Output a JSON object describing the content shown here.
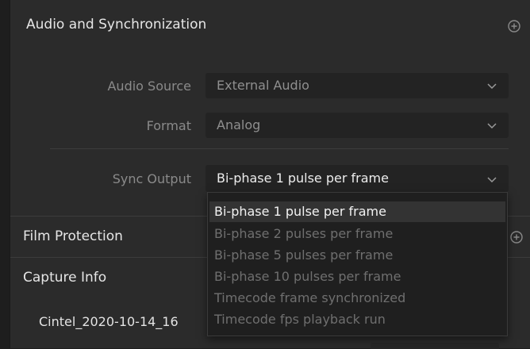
{
  "audio_sync": {
    "title": "Audio and Synchronization",
    "fields": [
      {
        "label": "Audio Source",
        "value": "External Audio"
      },
      {
        "label": "Format",
        "value": "Analog"
      },
      {
        "label": "Sync Output",
        "value": "Bi-phase 1 pulse per frame"
      }
    ]
  },
  "sync_menu": {
    "options": [
      "Bi-phase 1 pulse per frame",
      "Bi-phase 2 pulses per frame",
      "Bi-phase 5 pulses per frame",
      "Bi-phase 10 pulses per frame",
      "Timecode frame synchronized",
      "Timecode fps playback run"
    ],
    "selected": "Bi-phase 1 pulse per frame"
  },
  "film_protection": {
    "title": "Film Protection"
  },
  "capture_info": {
    "title": "Capture Info",
    "filename": "Cintel_2020-10-14_16"
  },
  "icons": {
    "reset": "reset-plus-icon",
    "chevron": "chevron-down-icon"
  },
  "colors": {
    "panel": "#2b2b2b",
    "field": "#232323",
    "menu": "#1f1f1f",
    "highlight": "#333333"
  }
}
